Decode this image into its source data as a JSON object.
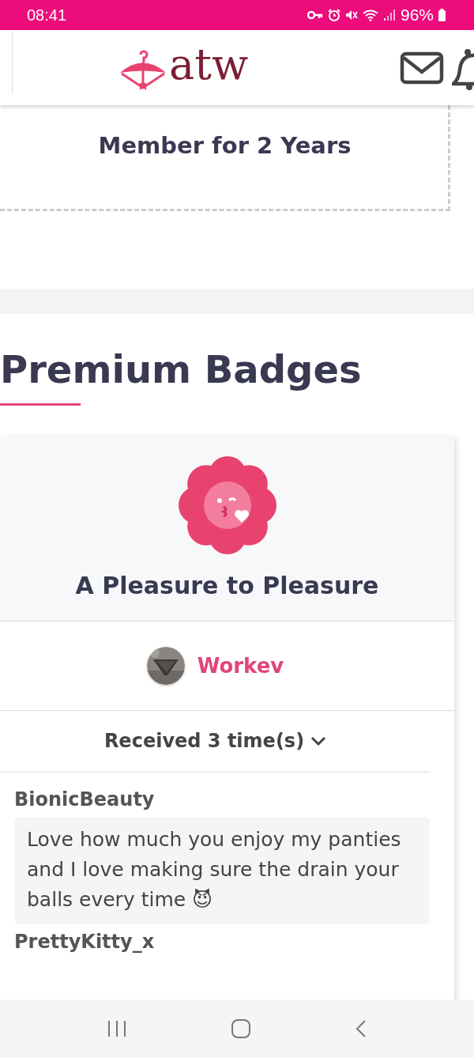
{
  "status_bar": {
    "time": "08:41",
    "battery": "96%"
  },
  "header": {
    "logo": "atw"
  },
  "member": {
    "text": "Member for 2 Years"
  },
  "section": {
    "title": "Premium Badges"
  },
  "badge": {
    "title": "A Pleasure to Pleasure",
    "seller": "Workev",
    "received": "Received 3 time(s)",
    "expanded": true,
    "comments": [
      {
        "author": "BionicBeauty",
        "text": "Love how much you enjoy my panties and I love making sure the drain your balls every time 😈"
      },
      {
        "author": "PrettyKitty_x"
      }
    ]
  }
}
